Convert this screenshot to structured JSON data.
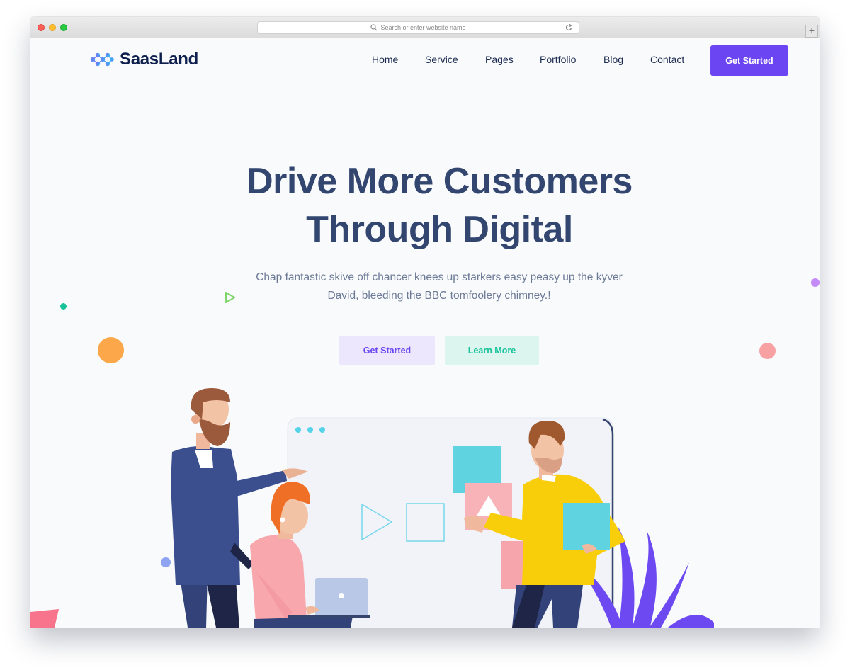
{
  "browser": {
    "url_placeholder": "Search or enter website name",
    "new_tab_symbol": "+"
  },
  "header": {
    "brand": "SaasLand",
    "nav": [
      {
        "label": "Home"
      },
      {
        "label": "Service"
      },
      {
        "label": "Pages"
      },
      {
        "label": "Portfolio"
      },
      {
        "label": "Blog"
      },
      {
        "label": "Contact"
      }
    ],
    "cta_label": "Get Started"
  },
  "hero": {
    "title_line1": "Drive More Customers",
    "title_line2": "Through Digital",
    "subtitle": "Chap fantastic skive off chancer knees up starkers easy peasy up the kyver David, bleeding the BBC tomfoolery chimney.!",
    "primary_button": "Get Started",
    "secondary_button": "Learn More"
  },
  "colors": {
    "accent": "#6b45f1",
    "heading": "#32466f",
    "teal": "#17c29a",
    "page_bg": "#f8fafc"
  },
  "icons": [
    "search-icon",
    "reload-icon",
    "logo-icon",
    "play-icon"
  ]
}
